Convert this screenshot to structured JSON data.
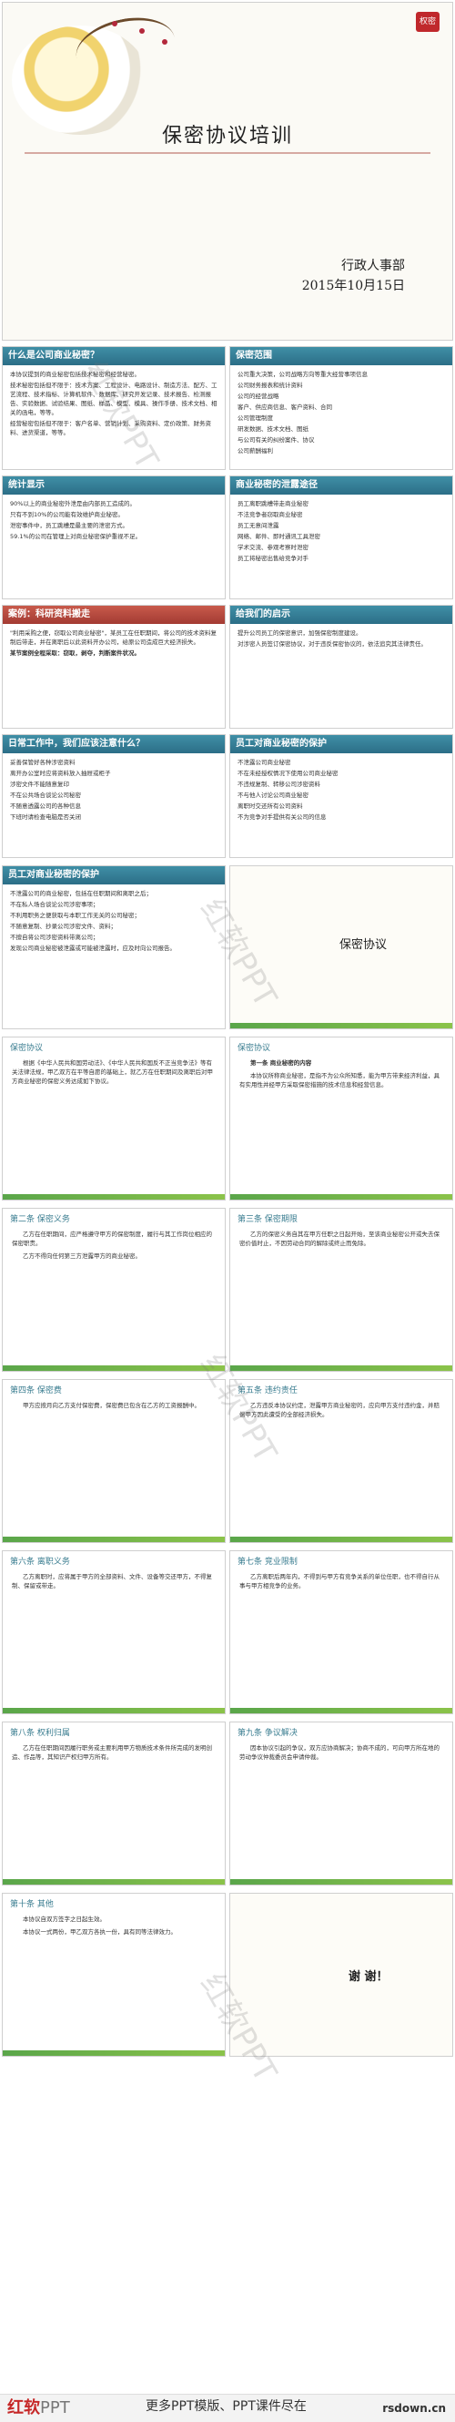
{
  "cover": {
    "title": "保密协议培训",
    "department": "行政人事部",
    "date": "2015年10月15日",
    "logo": "权密"
  },
  "slides": [
    {
      "title": "什么是公司商业秘密？",
      "lines": [
        "本协议提到的商业秘密包括技术秘密和经营秘密。",
        "技术秘密包括但不限于：技术方案、工程设计、电路设计、制造方法、配方、工艺流程、技术指标、计算机软件、数据库、研究开发记录、技术报告、检测报告、实验数据、试验结果、图纸、样品、模型、模具、操作手册、技术文档、相关的函电，等等。",
        "经营秘密包括但不限于：客户名单、营销计划、采购资料、定价政策、财务资料、进货渠道，等等。"
      ]
    },
    {
      "title": "保密范围",
      "lines": [
        "公司重大决策，公司战略方向等重大经营事项信息",
        "公司财务报表和统计资料",
        "公司的经营战略",
        "客户、供应商信息、客户资料、合同",
        "公司管理制度",
        "研发数据、技术文档、图纸",
        "与公司有关的纠纷案件、协议",
        "公司薪酬福利"
      ]
    },
    {
      "title": "统计显示",
      "lines": [
        "90%以上的商业秘密外泄是由内部员工造成的。",
        "只有不到10%的公司能有效维护商业秘密。",
        "泄密事件中，员工跳槽是最主要的泄密方式。",
        "59.1%的公司在管理上对商业秘密保护重视不足。"
      ]
    },
    {
      "title": "商业秘密的泄露途径",
      "lines": [
        "员工离职跳槽带走商业秘密",
        "不法竞争者窃取商业秘密",
        "员工无意间泄露",
        "网络、邮件、即时通讯工具泄密",
        "学术交流、参观考察时泄密",
        "员工将秘密出售给竞争对手"
      ]
    },
    {
      "title": "案例：科研资料搬走",
      "lines": [
        "\"利用采购之便，窃取公司商业秘密\"，某员工在任职期间，将公司的技术资料复制后带走，并在离职后以此资料开办公司，给原公司造成巨大经济损失。",
        "某节案例全程采取：窃取，剥夺，判断案件状况。"
      ]
    },
    {
      "title": "给我们的启示",
      "lines": [
        "提升公司员工的保密意识，加强保密制度建设。",
        "对涉密人员签订保密协议，对于违反保密协议的，依法追究其法律责任。"
      ]
    },
    {
      "title": "日常工作中，我们应该注意什么？",
      "lines": [
        "妥善保管好各种涉密资料",
        "离开办公室时应将资料放入抽屉或柜子",
        "涉密文件不能随意复印",
        "不在公共场合谈论公司秘密",
        "不随意透露公司的各种信息",
        "下班时请检查电脑是否关闭"
      ]
    },
    {
      "title": "员工对商业秘密的保护",
      "lines": [
        "不泄露公司商业秘密",
        "不在未经授权情况下使用公司商业秘密",
        "不违规复制、转移公司涉密资料",
        "不与他人讨论公司商业秘密",
        "离职时交还所有公司资料",
        "不为竞争对手提供有关公司的信息"
      ]
    }
  ],
  "protect": {
    "title": "员工对商业秘密的保护",
    "lines": [
      "不泄露公司的商业秘密，包括在任职期间和离职之后；",
      "不在私人场合谈论公司涉密事项；",
      "不利用职务之便获取与本职工作无关的公司秘密；",
      "不随意复制、抄录公司涉密文件、资料；",
      "不擅自将公司涉密资料带离公司；",
      "发现公司商业秘密被泄露或可能被泄露时，应及时向公司报告。"
    ]
  },
  "agreement_section": "保密协议",
  "agreement": [
    {
      "title": "保密协议",
      "lines": [
        "根据《中华人民共和国劳动法》、《中华人民共和国反不正当竞争法》等有关法律法规，甲乙双方在平等自愿的基础上，就乙方在任职期间及离职后对甲方商业秘密的保密义务达成如下协议。"
      ]
    },
    {
      "title": "保密协议",
      "lines": [
        "第一条 商业秘密的内容",
        "本协议所称商业秘密，是指不为公众所知悉，能为甲方带来经济利益，具有实用性并经甲方采取保密措施的技术信息和经营信息。"
      ]
    },
    {
      "title": "第二条 保密义务",
      "lines": [
        "乙方在任职期间，应严格遵守甲方的保密制度，履行与其工作岗位相应的保密职责。",
        "乙方不得向任何第三方泄露甲方的商业秘密。"
      ]
    },
    {
      "title": "第三条 保密期限",
      "lines": [
        "乙方的保密义务自其在甲方任职之日起开始，至该商业秘密公开或失去保密价值时止，不因劳动合同的解除或终止而免除。"
      ]
    },
    {
      "title": "第四条 保密费",
      "lines": [
        "甲方应按月向乙方支付保密费，保密费已包含在乙方的工资报酬中。"
      ]
    },
    {
      "title": "第五条 违约责任",
      "lines": [
        "乙方违反本协议约定，泄露甲方商业秘密的，应向甲方支付违约金，并赔偿甲方因此遭受的全部经济损失。"
      ]
    },
    {
      "title": "第六条 离职义务",
      "lines": [
        "乙方离职时，应将属于甲方的全部资料、文件、设备等交还甲方，不得复制、保留或带走。"
      ]
    },
    {
      "title": "第七条 竞业限制",
      "lines": [
        "乙方离职后两年内，不得到与甲方有竞争关系的单位任职，也不得自行从事与甲方相竞争的业务。"
      ]
    },
    {
      "title": "第八条 权利归属",
      "lines": [
        "乙方在任职期间因履行职务或主要利用甲方物质技术条件所完成的发明创造、作品等，其知识产权归甲方所有。"
      ]
    },
    {
      "title": "第九条 争议解决",
      "lines": [
        "因本协议引起的争议，双方应协商解决；协商不成的，可向甲方所在地的劳动争议仲裁委员会申请仲裁。"
      ]
    },
    {
      "title": "第十条 其他",
      "lines": [
        "本协议自双方签字之日起生效。",
        "本协议一式两份，甲乙双方各执一份，具有同等法律效力。"
      ]
    }
  ],
  "thanks": "谢  谢！",
  "watermark": "红软PPT",
  "footer": {
    "brand": "红软",
    "brand_suffix": "PPT",
    "tagline": "更多PPT模版、PPT课件尽在",
    "site": "rsdown.cn"
  }
}
